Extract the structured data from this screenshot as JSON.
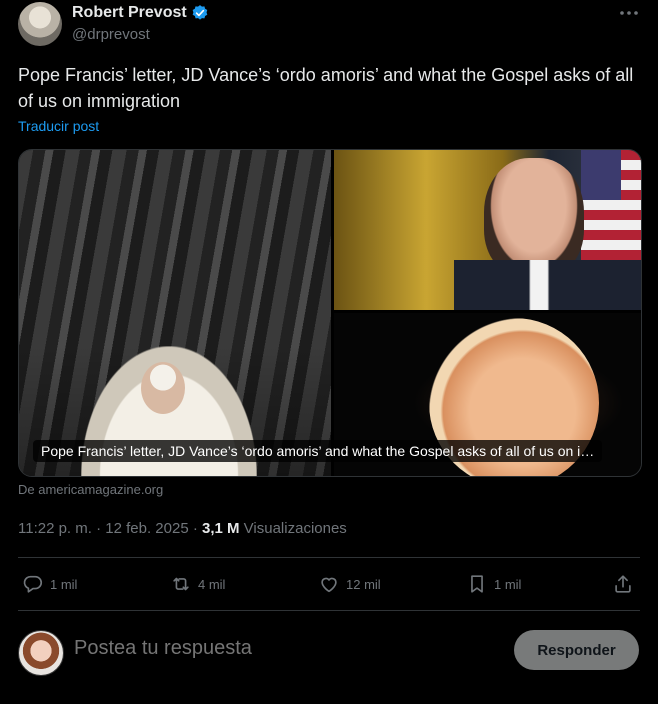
{
  "author": {
    "name": "Robert Prevost",
    "handle": "@drprevost"
  },
  "tweet": {
    "text": "Pope Francis’ letter, JD Vance’s ‘ordo amoris’ and what the Gospel asks of all of us on immigration",
    "translate_label": "Traducir post"
  },
  "card": {
    "caption": "Pope Francis’ letter, JD Vance’s ‘ordo amoris’ and what the Gospel asks of all of us on i…",
    "source": "De americamagazine.org"
  },
  "meta": {
    "time_date": "11:22 p. m. · 12 feb. 2025 · ",
    "views_count": "3,1 M",
    "views_label": " Visualizaciones"
  },
  "actions": {
    "replies": "1 mil",
    "reposts": "4 mil",
    "likes": "12 mil",
    "bookmarks": "1 mil"
  },
  "reply": {
    "placeholder": "Postea tu respuesta",
    "button_label": "Responder"
  },
  "colors": {
    "background": "#000000",
    "text": "#e7e9ea",
    "muted": "#71767b",
    "link": "#1d9bf0",
    "verified": "#1d9bf0",
    "border": "#2f3336"
  }
}
